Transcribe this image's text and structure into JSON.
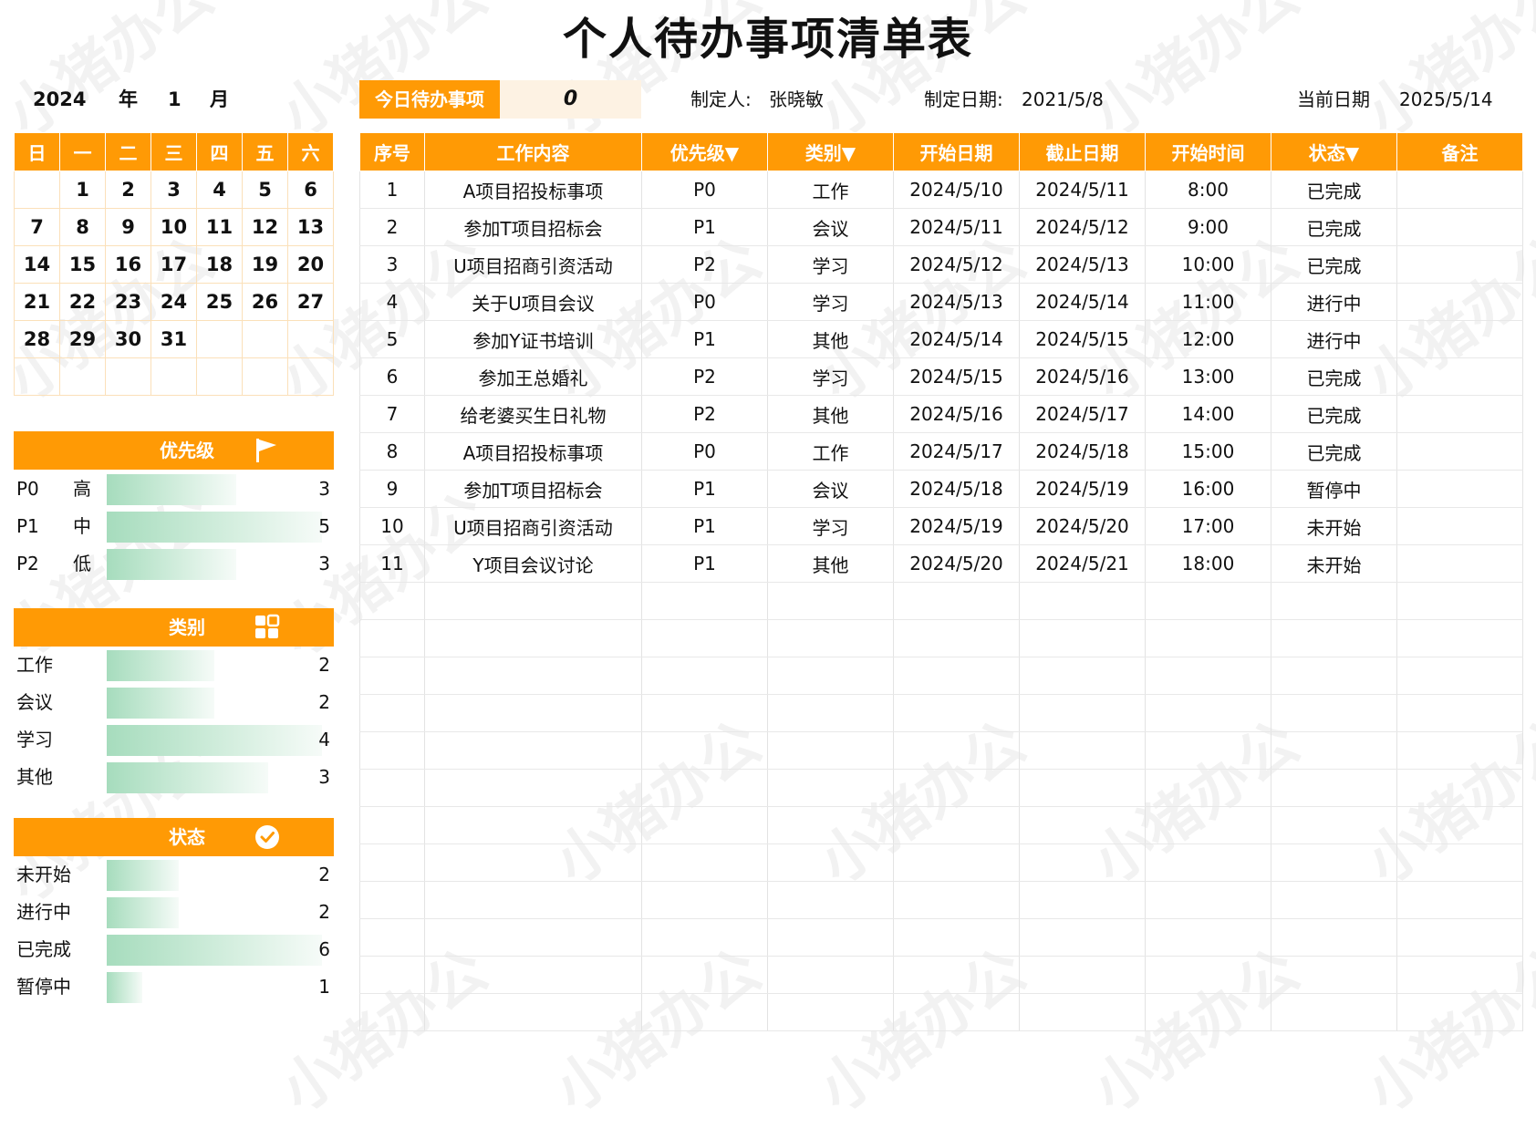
{
  "title": "个人待办事项清单表",
  "header": {
    "year": "2024",
    "year_unit": "年",
    "month": "1",
    "month_unit": "月",
    "today_label": "今日待办事项",
    "today_count": "0",
    "creator_label": "制定人:",
    "creator": "张晓敏",
    "made_date_label": "制定日期:",
    "made_date": "2021/5/8",
    "current_date_label": "当前日期",
    "current_date": "2025/5/14"
  },
  "calendar": {
    "weekdays": [
      "日",
      "一",
      "二",
      "三",
      "四",
      "五",
      "六"
    ],
    "weeks": [
      [
        "",
        "1",
        "2",
        "3",
        "4",
        "5",
        "6"
      ],
      [
        "7",
        "8",
        "9",
        "10",
        "11",
        "12",
        "13"
      ],
      [
        "14",
        "15",
        "16",
        "17",
        "18",
        "19",
        "20"
      ],
      [
        "21",
        "22",
        "23",
        "24",
        "25",
        "26",
        "27"
      ],
      [
        "28",
        "29",
        "30",
        "31",
        "",
        "",
        ""
      ],
      [
        "",
        "",
        "",
        "",
        "",
        "",
        ""
      ]
    ]
  },
  "priority_panel": {
    "title": "优先级",
    "icon": "flag-icon",
    "max": 5,
    "rows": [
      {
        "label": "P0",
        "sub": "高",
        "value": 3
      },
      {
        "label": "P1",
        "sub": "中",
        "value": 5
      },
      {
        "label": "P2",
        "sub": "低",
        "value": 3
      }
    ]
  },
  "category_panel": {
    "title": "类别",
    "icon": "grid-icon",
    "max": 4,
    "rows": [
      {
        "label": "工作",
        "value": 2
      },
      {
        "label": "会议",
        "value": 2
      },
      {
        "label": "学习",
        "value": 4
      },
      {
        "label": "其他",
        "value": 3
      }
    ]
  },
  "status_panel": {
    "title": "状态",
    "icon": "check-circle-icon",
    "max": 6,
    "rows": [
      {
        "label": "未开始",
        "value": 2
      },
      {
        "label": "进行中",
        "value": 2
      },
      {
        "label": "已完成",
        "value": 6
      },
      {
        "label": "暂停中",
        "value": 1
      }
    ]
  },
  "tasks": {
    "columns": [
      "序号",
      "工作内容",
      "优先级▼",
      "类别▼",
      "开始日期",
      "截止日期",
      "开始时间",
      "状态▼",
      "备注"
    ],
    "rows": [
      [
        "1",
        "A项目招投标事项",
        "P0",
        "工作",
        "2024/5/10",
        "2024/5/11",
        "8:00",
        "已完成",
        ""
      ],
      [
        "2",
        "参加T项目招标会",
        "P1",
        "会议",
        "2024/5/11",
        "2024/5/12",
        "9:00",
        "已完成",
        ""
      ],
      [
        "3",
        "U项目招商引资活动",
        "P2",
        "学习",
        "2024/5/12",
        "2024/5/13",
        "10:00",
        "已完成",
        ""
      ],
      [
        "4",
        "关于U项目会议",
        "P0",
        "学习",
        "2024/5/13",
        "2024/5/14",
        "11:00",
        "进行中",
        ""
      ],
      [
        "5",
        "参加Y证书培训",
        "P1",
        "其他",
        "2024/5/14",
        "2024/5/15",
        "12:00",
        "进行中",
        ""
      ],
      [
        "6",
        "参加王总婚礼",
        "P2",
        "学习",
        "2024/5/15",
        "2024/5/16",
        "13:00",
        "已完成",
        ""
      ],
      [
        "7",
        "给老婆买生日礼物",
        "P2",
        "其他",
        "2024/5/16",
        "2024/5/17",
        "14:00",
        "已完成",
        ""
      ],
      [
        "8",
        "A项目招投标事项",
        "P0",
        "工作",
        "2024/5/17",
        "2024/5/18",
        "15:00",
        "已完成",
        ""
      ],
      [
        "9",
        "参加T项目招标会",
        "P1",
        "会议",
        "2024/5/18",
        "2024/5/19",
        "16:00",
        "暂停中",
        ""
      ],
      [
        "10",
        "U项目招商引资活动",
        "P1",
        "学习",
        "2024/5/19",
        "2024/5/20",
        "17:00",
        "未开始",
        ""
      ],
      [
        "11",
        "Y项目会议讨论",
        "P1",
        "其他",
        "2024/5/20",
        "2024/5/21",
        "18:00",
        "未开始",
        ""
      ]
    ],
    "empty_rows": 12
  },
  "watermark": "小猪办公",
  "colors": {
    "accent": "#ff9a05",
    "bar": "#a6dcbd",
    "today_bg": "#fdf2e3"
  }
}
